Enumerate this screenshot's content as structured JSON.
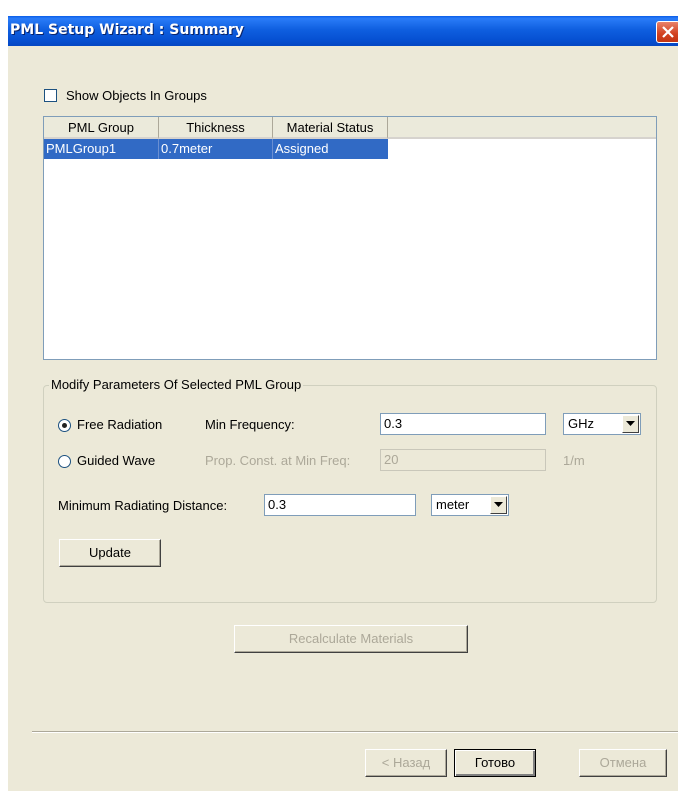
{
  "window": {
    "title": "PML Setup Wizard : Summary"
  },
  "show_groups": {
    "label": "Show Objects In Groups",
    "checked": false
  },
  "table": {
    "columns": [
      "PML Group",
      "Thickness",
      "Material Status"
    ],
    "rows": [
      {
        "group": "PMLGroup1",
        "thickness": "0.7meter",
        "status": "Assigned"
      }
    ]
  },
  "params": {
    "legend": "Modify Parameters Of Selected PML Group",
    "free_radiation": {
      "label": "Free Radiation",
      "selected": true
    },
    "min_frequency": {
      "label": "Min Frequency:",
      "value": "0.3",
      "unit": "GHz"
    },
    "guided_wave": {
      "label": "Guided Wave",
      "selected": false
    },
    "prop_const": {
      "label": "Prop. Const. at Min Freq:",
      "value": "20",
      "unit": "1/m"
    },
    "min_radiating": {
      "label": "Minimum Radiating Distance:",
      "value": "0.3",
      "unit": "meter"
    },
    "update_label": "Update"
  },
  "recalculate_label": "Recalculate Materials",
  "footer": {
    "back_label": "< Назад",
    "finish_label": "Готово",
    "cancel_label": "Отмена"
  },
  "colors": {
    "title_bar": "#0553d2",
    "selection": "#316ac5",
    "dialog_bg": "#ece9d8"
  }
}
